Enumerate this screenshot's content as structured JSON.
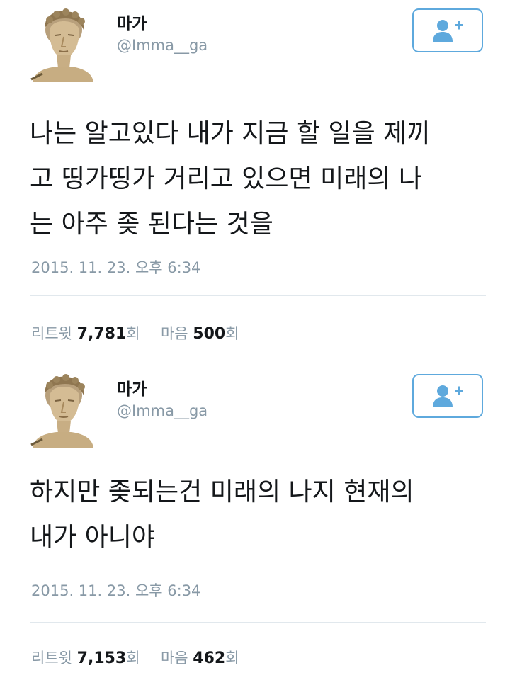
{
  "tweets": [
    {
      "author": {
        "name": "마가",
        "handle": "@Imma__ga"
      },
      "follow_icon": "follow-user-plus-icon",
      "text": "나는 알고있다 내가 지금 할 일을 제끼\n고 띵가띵가 거리고 있으면 미래의 나\n는 아주 좆 된다는 것을",
      "timestamp": "2015. 11. 23. 오후 6:34",
      "stats": {
        "retweet_label": "리트윗",
        "retweet_count": "7,781",
        "retweet_unit": "회",
        "like_label": "마음",
        "like_count": "500",
        "like_unit": "회"
      }
    },
    {
      "author": {
        "name": "마가",
        "handle": "@Imma__ga"
      },
      "follow_icon": "follow-user-plus-icon",
      "text": "하지만 좆되는건 미래의 나지 현재의\n내가 아니야",
      "timestamp": "2015. 11. 23. 오후 6:34",
      "stats": {
        "retweet_label": "리트윗",
        "retweet_count": "7,153",
        "retweet_unit": "회",
        "like_label": "마음",
        "like_count": "462",
        "like_unit": "회"
      }
    }
  ],
  "colors": {
    "accent": "#5ea9dd",
    "muted_text": "#8899a6",
    "body_text": "#14171a",
    "divider": "#e1e8ed"
  }
}
